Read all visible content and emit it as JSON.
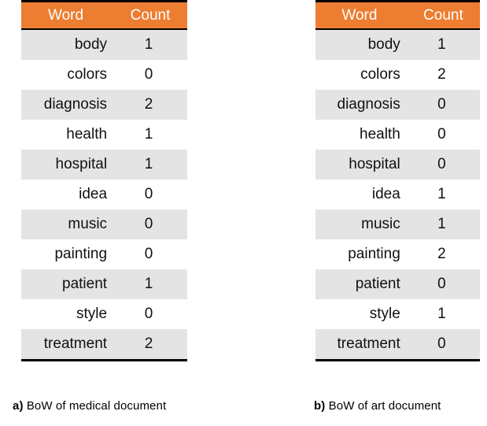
{
  "figure": {
    "type": "two-tables",
    "background_color": "#FFFFFF",
    "header_color": "#ED7D31",
    "header_text_color": "#FFFFFF",
    "shaded_row_color": "#E4E4E4",
    "rule_color": "#000000"
  },
  "panels": [
    {
      "id": "panel-a",
      "caption_label": "a)",
      "caption_text": "BoW of medical document",
      "table": {
        "columns": [
          "Word",
          "Count"
        ],
        "rows": [
          {
            "word": "body",
            "count": "1"
          },
          {
            "word": "colors",
            "count": "0"
          },
          {
            "word": "diagnosis",
            "count": "2"
          },
          {
            "word": "health",
            "count": "1"
          },
          {
            "word": "hospital",
            "count": "1"
          },
          {
            "word": "idea",
            "count": "0"
          },
          {
            "word": "music",
            "count": "0"
          },
          {
            "word": "painting",
            "count": "0"
          },
          {
            "word": "patient",
            "count": "1"
          },
          {
            "word": "style",
            "count": "0"
          },
          {
            "word": "treatment",
            "count": "2"
          }
        ]
      }
    },
    {
      "id": "panel-b",
      "caption_label": "b)",
      "caption_text": "BoW of art document",
      "table": {
        "columns": [
          "Word",
          "Count"
        ],
        "rows": [
          {
            "word": "body",
            "count": "1"
          },
          {
            "word": "colors",
            "count": "2"
          },
          {
            "word": "diagnosis",
            "count": "0"
          },
          {
            "word": "health",
            "count": "0"
          },
          {
            "word": "hospital",
            "count": "0"
          },
          {
            "word": "idea",
            "count": "1"
          },
          {
            "word": "music",
            "count": "1"
          },
          {
            "word": "painting",
            "count": "2"
          },
          {
            "word": "patient",
            "count": "0"
          },
          {
            "word": "style",
            "count": "1"
          },
          {
            "word": "treatment",
            "count": "0"
          }
        ]
      }
    }
  ],
  "chart_data": {
    "type": "table",
    "title": "",
    "categories": [
      "body",
      "colors",
      "diagnosis",
      "health",
      "hospital",
      "idea",
      "music",
      "painting",
      "patient",
      "style",
      "treatment"
    ],
    "series": [
      {
        "name": "a) BoW of medical document",
        "values": [
          1,
          0,
          2,
          1,
          1,
          0,
          0,
          0,
          1,
          0,
          2
        ]
      },
      {
        "name": "b) BoW of art document",
        "values": [
          1,
          2,
          0,
          0,
          0,
          1,
          1,
          2,
          0,
          1,
          0
        ]
      }
    ],
    "xlabel": "Word",
    "ylabel": "Count",
    "legend_position": "below"
  }
}
